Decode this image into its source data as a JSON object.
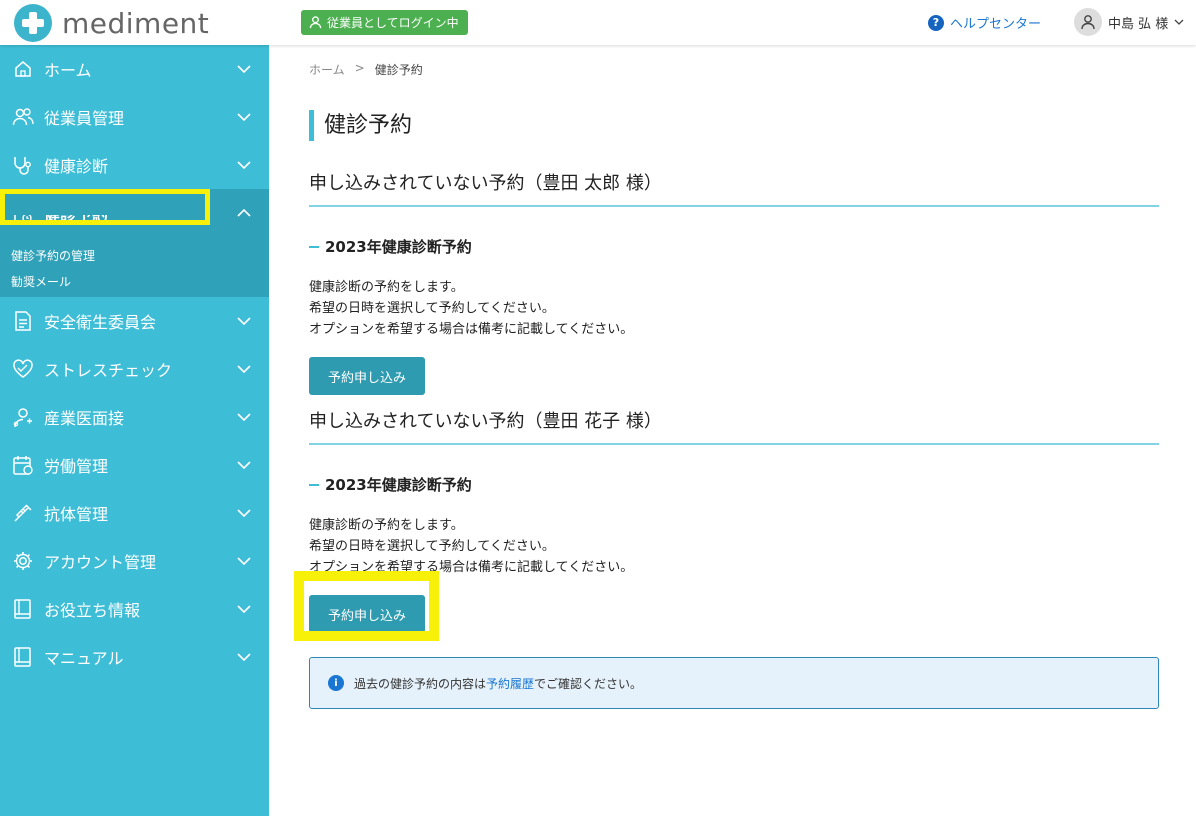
{
  "header": {
    "logo_text": "mediment",
    "login_badge": "従業員としてログイン中",
    "help_label": "ヘルプセンター",
    "user_name": "中島 弘 様"
  },
  "sidebar": {
    "items": [
      {
        "label": "ホーム",
        "icon": "home-icon"
      },
      {
        "label": "従業員管理",
        "icon": "users-icon"
      },
      {
        "label": "健康診断",
        "icon": "stethoscope-icon"
      },
      {
        "label": "健診予約",
        "icon": "clipboard-icon",
        "expanded": true
      },
      {
        "label": "安全衛生委員会",
        "icon": "document-icon"
      },
      {
        "label": "ストレスチェック",
        "icon": "heart-icon"
      },
      {
        "label": "産業医面接",
        "icon": "doctor-icon"
      },
      {
        "label": "労働管理",
        "icon": "calendar-icon"
      },
      {
        "label": "抗体管理",
        "icon": "syringe-icon"
      },
      {
        "label": "アカウント管理",
        "icon": "gear-icon"
      },
      {
        "label": "お役立ち情報",
        "icon": "book-icon"
      },
      {
        "label": "マニュアル",
        "icon": "book-icon"
      }
    ],
    "sub_items": [
      "健診予約の管理",
      "勧奨メール"
    ]
  },
  "breadcrumb": {
    "home": "ホーム",
    "sep": ">",
    "current": "健診予約"
  },
  "page_title": "健診予約",
  "sections": [
    {
      "title": "申し込みされていない予約（豊田 太郎 様）",
      "subtitle": "2023年健康診断予約",
      "lines": [
        "健康診断の予約をします。",
        "希望の日時を選択して予約してください。",
        "オプションを希望する場合は備考に記載してください。"
      ],
      "button": "予約申し込み"
    },
    {
      "title": "申し込みされていない予約（豊田 花子 様）",
      "subtitle": "2023年健康診断予約",
      "lines": [
        "健康診断の予約をします。",
        "希望の日時を選択して予約してください。",
        "オプションを希望する場合は備考に記載してください。"
      ],
      "button": "予約申し込み"
    }
  ],
  "info": {
    "before": "過去の健診予約の内容は",
    "link": "予約履歴",
    "after": "でご確認ください。"
  },
  "colors": {
    "sidebar": "#3ebdd6",
    "sidebar_active": "#2fa1b9",
    "button": "#2e9bb0",
    "highlight": "#f7f10a"
  }
}
